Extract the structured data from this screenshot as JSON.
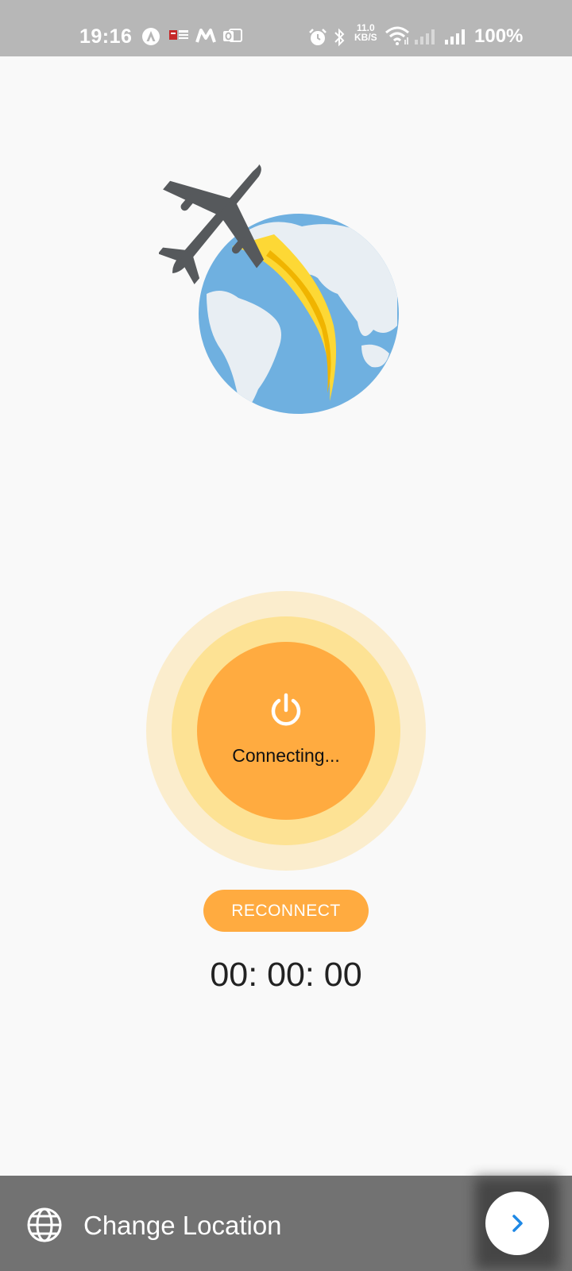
{
  "status_bar": {
    "time": "19:16",
    "network_speed_value": "11.0",
    "network_speed_unit": "KB/S",
    "battery": "100%",
    "icons": [
      "arcore-icon",
      "news-icon",
      "m-icon",
      "outlook-icon",
      "alarm-icon",
      "bluetooth-icon",
      "wifi-icon",
      "signal-icon",
      "signal-icon"
    ]
  },
  "hero": {
    "icon": "airplane-globe-illustration"
  },
  "connection": {
    "status_label": "Connecting...",
    "reconnect_label": "RECONNECT",
    "timer": "00: 00: 00"
  },
  "bottom_bar": {
    "label": "Change Location",
    "left_icon": "globe-icon",
    "right_icon": "chevron-right-icon"
  },
  "colors": {
    "accent": "#ffab40",
    "ring_inner": "#fde294",
    "ring_outer": "#fbedcd",
    "bottom_bar": "#727272",
    "chevron": "#1e88e5"
  }
}
